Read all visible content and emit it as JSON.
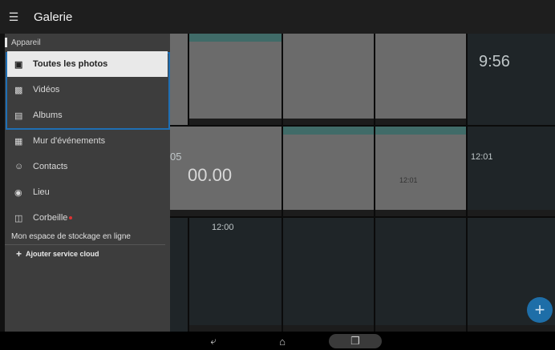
{
  "app": {
    "title": "Galerie",
    "menu_icon": "hamburger-icon"
  },
  "drawer": {
    "section_device": "Appareil",
    "items": [
      {
        "label": "Toutes les photos",
        "icon": "photos-icon",
        "active": true
      },
      {
        "label": "Vidéos",
        "icon": "video-icon"
      },
      {
        "label": "Albums",
        "icon": "album-icon"
      },
      {
        "label": "Mur d'événements",
        "icon": "calendar-icon"
      },
      {
        "label": "Contacts",
        "icon": "contacts-icon"
      },
      {
        "label": "Lieu",
        "icon": "location-icon"
      },
      {
        "label": "Corbeille",
        "icon": "trash-icon",
        "badge_color": "#dd3333"
      }
    ],
    "cloud": {
      "title": "Mon espace de stockage en ligne",
      "add_label": "Ajouter service cloud"
    }
  },
  "grid": {
    "clock_1": "9:56",
    "clock_2": "12:01",
    "clock_3": "00.00",
    "clock_4": "12:00",
    "clock_5": "05",
    "clock_6": "12:01"
  },
  "nav": {
    "back": "back-icon",
    "home": "home-icon",
    "recent": "recent-apps-icon"
  },
  "colors": {
    "accent": "#1f6fb4",
    "fab": "#1e6ea8",
    "drawer": "#3d3d3d",
    "active_item": "#e9e9e9"
  }
}
